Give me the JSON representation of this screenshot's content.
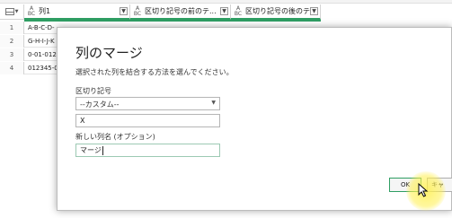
{
  "grid": {
    "columns": [
      {
        "label": "列1",
        "type": "ABC"
      },
      {
        "label": "区切り記号の前のテ...",
        "type": "ABC"
      },
      {
        "label": "区切り記号の後のテ...",
        "type": "ABC"
      }
    ],
    "rows": [
      {
        "num": "1",
        "value": "A-B-C-D-"
      },
      {
        "num": "2",
        "value": "G-H-I-J-K"
      },
      {
        "num": "3",
        "value": "0-01-012"
      },
      {
        "num": "4",
        "value": "012345-0"
      }
    ]
  },
  "dialog": {
    "title": "列のマージ",
    "description": "選択された列を結合する方法を選んでください。",
    "separator_label": "区切り記号",
    "separator_value": "--カスタム--",
    "custom_value": "X",
    "new_column_label": "新しい列名 (オプション)",
    "new_column_value": "マージ",
    "ok_label": "OK",
    "cancel_label": "キャ"
  },
  "colors": {
    "accent": "#2f9e63",
    "highlight": "#fff050"
  }
}
